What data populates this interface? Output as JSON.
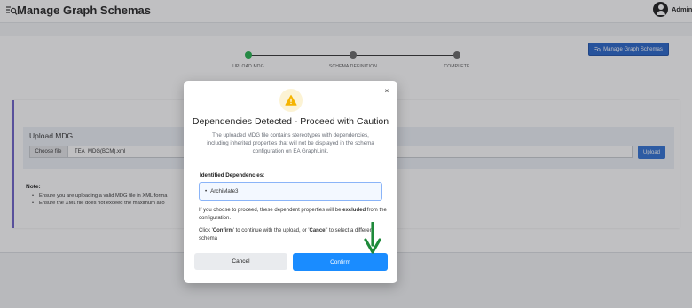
{
  "header": {
    "title": "Manage Graph Schemas",
    "user": "Admin"
  },
  "toolbar": {
    "manage_label": "Manage Graph Schemas"
  },
  "stepper": {
    "steps": [
      "UPLOAD MDG",
      "SCHEMA DEFINITION",
      "COMPLETE"
    ],
    "active_step": 1
  },
  "upload": {
    "title": "Upload MDG",
    "choose_label": "Choose file",
    "file_name": "TEA_MDG(BCM).xml",
    "upload_label": "Upload"
  },
  "notes": {
    "title": "Note:",
    "items": [
      "Ensure you are uploading a valid MDG file in XML forma",
      "Ensure the XML file does not exceed the maximum allo"
    ]
  },
  "modal": {
    "title": "Dependencies Detected - Proceed with Caution",
    "description": "The uploaded MDG file contains stereotypes with dependencies, including inherited properties that will not be displayed in the schema configuration on EA GraphLink.",
    "dependencies_label": "Identified Dependencies:",
    "dependencies": [
      "ArchiMate3"
    ],
    "info_1_prefix": "If you choose to proceed, these dependent properties will be ",
    "info_1_bold": "excluded",
    "info_1_suffix": " from the configuration.",
    "info_2_prefix": "Click '",
    "info_2_confirm": "Confirm",
    "info_2_mid": "' to continue with the upload, or '",
    "info_2_cancel": "Cancel",
    "info_2_suffix": "' to select a different schema",
    "cancel_label": "Cancel",
    "confirm_label": "Confirm",
    "close_label": "×"
  },
  "colors": {
    "primary": "#1a8cff",
    "manage_button": "#2563c9",
    "active_step": "#21b04b",
    "warning": "#f5b400",
    "arrow": "#1e8a3a"
  },
  "icons": {
    "logo": "schema-search-icon",
    "warning": "warning-triangle-icon",
    "manage": "schema-list-icon",
    "close": "close-icon",
    "avatar": "user-avatar-icon",
    "arrow": "down-arrow-annotation"
  }
}
